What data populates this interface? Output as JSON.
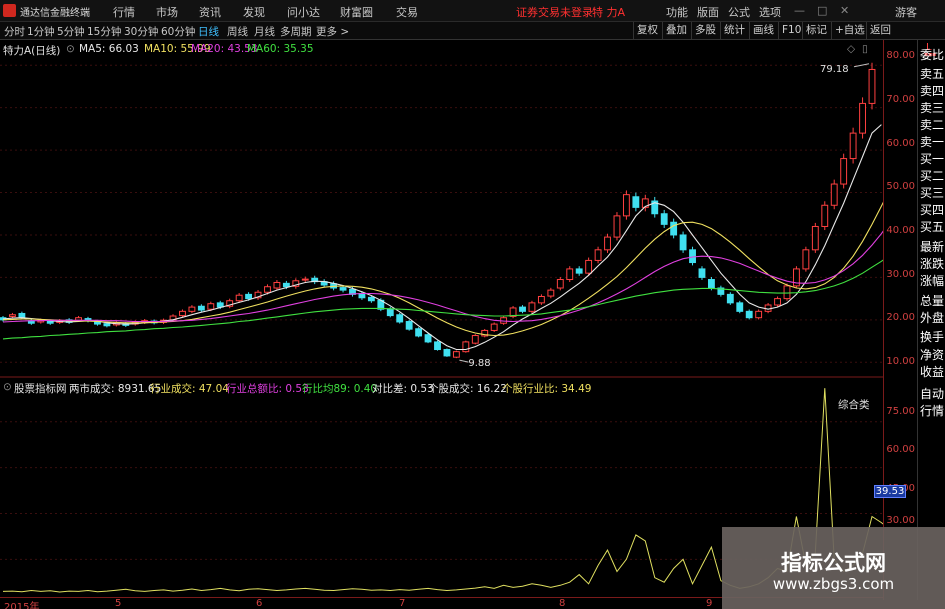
{
  "topbar": {
    "app_name": "通达信金融终端",
    "menu": [
      "行情",
      "市场",
      "资讯",
      "发现",
      "问小达",
      "财富圈",
      "交易"
    ],
    "trade_status": "证券交易未登录",
    "stock_name": "特 力A",
    "right_menu": [
      "功能",
      "版面",
      "公式",
      "选项"
    ],
    "guest": "游客",
    "colors": {
      "logo": "#d0281f",
      "alert": "#ff3030"
    }
  },
  "tabs": {
    "periods": [
      "分时",
      "1分钟",
      "5分钟",
      "15分钟",
      "30分钟",
      "60分钟",
      "日线",
      "周线",
      "月线",
      "多周期",
      "更多 >"
    ],
    "active_period": "日线",
    "right_buttons": [
      "复权",
      "叠加",
      "多股",
      "统计",
      "画线",
      "F10",
      "标记",
      "+自选",
      "返回"
    ]
  },
  "price_legend": {
    "title": "特力A(日线)",
    "ma": [
      {
        "label": "MA5: 66.03",
        "color": "#e8e8e8"
      },
      {
        "label": "MA10: 55.99",
        "color": "#f0e060"
      },
      {
        "label": "MA20: 43.53",
        "color": "#e040e0"
      },
      {
        "label": "MA60: 35.35",
        "color": "#40e040"
      }
    ],
    "high_label": "79.18",
    "low_label": "9.88"
  },
  "indicator_legend": {
    "title": "股票指标网",
    "items": [
      {
        "label": "两市成交: 8931.65",
        "color": "#e8e8e8"
      },
      {
        "label": "行业成交: 47.04",
        "color": "#f0e060"
      },
      {
        "label": "行业总额比: 0.53",
        "color": "#e040e0"
      },
      {
        "label": "行比均89: 0.40",
        "color": "#40e040"
      },
      {
        "label": "对比差: 0.53",
        "color": "#e8e8e8"
      },
      {
        "label": "个股成交: 16.22",
        "color": "#e8e8e8"
      },
      {
        "label": "个股行业比: 34.49",
        "color": "#f0e060"
      }
    ],
    "panel_label": "综合类",
    "current_value": "39.53"
  },
  "price_axis": [
    "80.00",
    "70.00",
    "60.00",
    "50.00",
    "40.00",
    "30.00",
    "20.00",
    "10.00"
  ],
  "indicator_axis": [
    "75.00",
    "60.00",
    "45.00",
    "30.00"
  ],
  "date_axis": [
    "2015年",
    "5",
    "6",
    "7",
    "8",
    "9"
  ],
  "sidebar": {
    "items": [
      "委比",
      "卖五",
      "卖四",
      "卖三",
      "卖二",
      "卖一",
      "买一",
      "买二",
      "买三",
      "买四",
      "买五",
      "最新",
      "涨跌",
      "涨幅",
      "总量",
      "外盘",
      "换手",
      "净资",
      "收益",
      "自动",
      "行情"
    ]
  },
  "watermark": {
    "line1": "指标公式网",
    "line2": "www.zbgs3.com"
  },
  "chart_data": [
    {
      "type": "candlestick",
      "title": "特力A(日线)",
      "ylim": [
        7,
        85
      ],
      "y_ticks": [
        10,
        20,
        30,
        40,
        50,
        60,
        70,
        80
      ],
      "candles": [
        {
          "o": 20.5,
          "c": 20.0
        },
        {
          "o": 20.8,
          "c": 21.2
        },
        {
          "o": 21.5,
          "c": 20.6
        },
        {
          "o": 19.8,
          "c": 19.2
        },
        {
          "o": 19.5,
          "c": 19.9
        },
        {
          "o": 19.7,
          "c": 19.2
        },
        {
          "o": 19.4,
          "c": 19.8
        },
        {
          "o": 20.0,
          "c": 19.4
        },
        {
          "o": 19.9,
          "c": 20.5
        },
        {
          "o": 20.3,
          "c": 19.8
        },
        {
          "o": 19.6,
          "c": 19.0
        },
        {
          "o": 19.1,
          "c": 18.6
        },
        {
          "o": 18.8,
          "c": 19.3
        },
        {
          "o": 19.1,
          "c": 18.7
        },
        {
          "o": 19.0,
          "c": 19.5
        },
        {
          "o": 19.4,
          "c": 19.8
        },
        {
          "o": 19.7,
          "c": 19.3
        },
        {
          "o": 19.4,
          "c": 19.9
        },
        {
          "o": 20.0,
          "c": 20.9
        },
        {
          "o": 21.0,
          "c": 22.0
        },
        {
          "o": 22.0,
          "c": 23.0
        },
        {
          "o": 23.2,
          "c": 22.3
        },
        {
          "o": 22.5,
          "c": 23.8
        },
        {
          "o": 24.0,
          "c": 23.0
        },
        {
          "o": 23.2,
          "c": 24.5
        },
        {
          "o": 24.5,
          "c": 25.8
        },
        {
          "o": 26.0,
          "c": 25.0
        },
        {
          "o": 25.2,
          "c": 26.5
        },
        {
          "o": 26.5,
          "c": 27.8
        },
        {
          "o": 27.5,
          "c": 28.8
        },
        {
          "o": 28.6,
          "c": 27.8
        },
        {
          "o": 27.9,
          "c": 29.2
        },
        {
          "o": 29.4,
          "c": 29.6
        },
        {
          "o": 29.8,
          "c": 29.0
        },
        {
          "o": 29.0,
          "c": 28.2
        },
        {
          "o": 28.5,
          "c": 27.5
        },
        {
          "o": 27.6,
          "c": 27.0
        },
        {
          "o": 27.2,
          "c": 26.0
        },
        {
          "o": 26.2,
          "c": 25.2
        },
        {
          "o": 25.3,
          "c": 24.5
        },
        {
          "o": 24.6,
          "c": 22.5
        },
        {
          "o": 22.6,
          "c": 21.0
        },
        {
          "o": 21.2,
          "c": 19.5
        },
        {
          "o": 19.6,
          "c": 17.8
        },
        {
          "o": 17.9,
          "c": 16.2
        },
        {
          "o": 16.5,
          "c": 14.8
        },
        {
          "o": 14.8,
          "c": 13.0
        },
        {
          "o": 13.0,
          "c": 11.5
        },
        {
          "o": 11.2,
          "c": 12.5
        },
        {
          "o": 12.5,
          "c": 14.8
        },
        {
          "o": 14.5,
          "c": 16.3
        },
        {
          "o": 16.2,
          "c": 17.5
        },
        {
          "o": 17.5,
          "c": 19.0
        },
        {
          "o": 19.2,
          "c": 20.5
        },
        {
          "o": 20.8,
          "c": 22.8
        },
        {
          "o": 23.0,
          "c": 22.0
        },
        {
          "o": 22.0,
          "c": 24.0
        },
        {
          "o": 24.0,
          "c": 25.5
        },
        {
          "o": 25.6,
          "c": 27.0
        },
        {
          "o": 27.5,
          "c": 29.5
        },
        {
          "o": 29.5,
          "c": 32.0
        },
        {
          "o": 32.0,
          "c": 31.0
        },
        {
          "o": 31.0,
          "c": 34.0
        },
        {
          "o": 34.0,
          "c": 36.5
        },
        {
          "o": 36.5,
          "c": 39.5
        },
        {
          "o": 39.5,
          "c": 44.5
        },
        {
          "o": 44.5,
          "c": 49.5
        },
        {
          "o": 49.0,
          "c": 46.5
        },
        {
          "o": 46.5,
          "c": 48.5
        },
        {
          "o": 48.0,
          "c": 45.0
        },
        {
          "o": 45.0,
          "c": 42.5
        },
        {
          "o": 43.0,
          "c": 40.0
        },
        {
          "o": 40.0,
          "c": 36.5
        },
        {
          "o": 36.5,
          "c": 33.5
        },
        {
          "o": 32.0,
          "c": 30.0
        },
        {
          "o": 29.5,
          "c": 27.5
        },
        {
          "o": 27.5,
          "c": 26.0
        },
        {
          "o": 26.0,
          "c": 24.0
        },
        {
          "o": 24.0,
          "c": 22.0
        },
        {
          "o": 22.0,
          "c": 20.5
        },
        {
          "o": 20.5,
          "c": 22.0
        },
        {
          "o": 22.0,
          "c": 23.5
        },
        {
          "o": 23.5,
          "c": 25.0
        },
        {
          "o": 25.0,
          "c": 28.0
        },
        {
          "o": 28.0,
          "c": 32.0
        },
        {
          "o": 32.0,
          "c": 36.5
        },
        {
          "o": 36.5,
          "c": 42.0
        },
        {
          "o": 42.0,
          "c": 47.0
        },
        {
          "o": 47.0,
          "c": 52.0
        },
        {
          "o": 52.0,
          "c": 58.0
        },
        {
          "o": 58.0,
          "c": 64.0
        },
        {
          "o": 64.0,
          "c": 71.0
        },
        {
          "o": 71.0,
          "c": 79.0
        }
      ],
      "series": [
        {
          "name": "MA5",
          "color": "#e8e8e8",
          "values": [
            20.2,
            20.4,
            20.5,
            20.3,
            20.1,
            19.8,
            19.6,
            19.5,
            19.6,
            19.8,
            19.7,
            19.3,
            19.1,
            19.0,
            19.1,
            19.3,
            19.5,
            19.7,
            20.0,
            20.6,
            21.2,
            21.8,
            22.3,
            22.9,
            23.5,
            24.1,
            24.7,
            25.4,
            26.2,
            27.0,
            27.6,
            28.2,
            28.8,
            29.1,
            29.0,
            28.6,
            28.1,
            27.4,
            26.6,
            25.7,
            24.6,
            23.3,
            21.9,
            20.3,
            18.6,
            16.9,
            15.3,
            13.9,
            13.0,
            13.0,
            13.7,
            14.7,
            15.9,
            17.2,
            18.8,
            20.2,
            21.4,
            22.7,
            23.9,
            25.4,
            27.0,
            28.6,
            30.5,
            32.7,
            34.8,
            37.6,
            41.0,
            44.5,
            46.7,
            47.6,
            47.0,
            45.5,
            43.0,
            40.0,
            37.0,
            34.0,
            31.0,
            28.5,
            26.0,
            24.0,
            23.0,
            22.5,
            23.0,
            24.0,
            26.0,
            29.0,
            33.0,
            37.5,
            42.5,
            47.5,
            53.0,
            58.5,
            64.0,
            66.0
          ]
        },
        {
          "name": "MA10",
          "color": "#f0e060",
          "values": [
            20.0,
            20.1,
            20.2,
            20.2,
            20.1,
            20.0,
            19.9,
            19.8,
            19.7,
            19.7,
            19.6,
            19.5,
            19.4,
            19.3,
            19.3,
            19.3,
            19.4,
            19.5,
            19.6,
            19.8,
            20.1,
            20.5,
            20.9,
            21.3,
            21.8,
            22.4,
            23.0,
            23.6,
            24.2,
            24.9,
            25.6,
            26.2,
            26.8,
            27.3,
            27.7,
            27.9,
            28.0,
            27.9,
            27.7,
            27.3,
            26.7,
            26.0,
            25.1,
            24.0,
            22.8,
            21.6,
            20.4,
            19.3,
            18.3,
            17.5,
            16.9,
            16.5,
            16.3,
            16.4,
            16.8,
            17.4,
            18.1,
            18.9,
            19.9,
            21.0,
            22.2,
            23.6,
            25.1,
            26.7,
            28.4,
            30.2,
            32.3,
            34.6,
            36.9,
            39.0,
            40.8,
            42.2,
            42.9,
            43.0,
            42.5,
            41.5,
            40.0,
            38.3,
            36.4,
            34.4,
            32.5,
            30.7,
            29.2,
            28.2,
            27.5,
            27.3,
            27.6,
            28.5,
            30.0,
            32.2,
            35.0,
            38.5,
            42.5,
            46.8,
            51.2,
            56.0
          ]
        },
        {
          "name": "MA20",
          "color": "#e040e0",
          "values": [
            19.5,
            19.6,
            19.7,
            19.8,
            19.8,
            19.9,
            19.9,
            19.9,
            19.9,
            19.9,
            19.9,
            19.8,
            19.8,
            19.7,
            19.6,
            19.6,
            19.6,
            19.6,
            19.7,
            19.8,
            19.9,
            20.1,
            20.3,
            20.6,
            20.9,
            21.2,
            21.5,
            21.9,
            22.3,
            22.8,
            23.3,
            23.8,
            24.3,
            24.8,
            25.2,
            25.6,
            25.9,
            26.1,
            26.2,
            26.2,
            26.1,
            25.9,
            25.6,
            25.2,
            24.7,
            24.1,
            23.5,
            22.8,
            22.1,
            21.4,
            20.8,
            20.3,
            19.9,
            19.7,
            19.6,
            19.7,
            19.8,
            20.1,
            20.5,
            21.0,
            21.6,
            22.3,
            23.1,
            24.0,
            25.0,
            26.1,
            27.3,
            28.6,
            30.0,
            31.4,
            32.6,
            33.6,
            34.4,
            34.8,
            35.0,
            34.9,
            34.6,
            34.0,
            33.3,
            32.4,
            31.5,
            30.6,
            29.8,
            29.1,
            28.7,
            28.6,
            28.8,
            29.4,
            30.3,
            31.6,
            33.2,
            35.2,
            37.6,
            40.3,
            43.5
          ]
        },
        {
          "name": "MA60",
          "color": "#40e040",
          "values": [
            15.5,
            15.7,
            15.8,
            16.0,
            16.1,
            16.3,
            16.4,
            16.6,
            16.7,
            16.9,
            17.0,
            17.2,
            17.3,
            17.4,
            17.6,
            17.7,
            17.9,
            18.0,
            18.2,
            18.3,
            18.5,
            18.7,
            18.9,
            19.1,
            19.3,
            19.6,
            19.8,
            20.1,
            20.4,
            20.7,
            21.0,
            21.3,
            21.6,
            21.9,
            22.1,
            22.3,
            22.5,
            22.6,
            22.7,
            22.7,
            22.7,
            22.6,
            22.5,
            22.4,
            22.2,
            22.0,
            21.8,
            21.6,
            21.4,
            21.2,
            21.1,
            21.0,
            20.9,
            20.9,
            21.0,
            21.1,
            21.2,
            21.4,
            21.7,
            22.0,
            22.3,
            22.7,
            23.1,
            23.6,
            24.1,
            24.6,
            25.1,
            25.6,
            26.0,
            26.4,
            26.7,
            27.0,
            27.2,
            27.3,
            27.4,
            27.4,
            27.3,
            27.1,
            26.9,
            26.7,
            26.5,
            26.4,
            26.3,
            26.3,
            26.4,
            26.6,
            26.9,
            27.4,
            28.0,
            28.8,
            29.8,
            31.0,
            32.4,
            33.8,
            35.35
          ]
        }
      ]
    },
    {
      "type": "line",
      "title": "股票指标网",
      "ylim": [
        18,
        88
      ],
      "y_ticks": [
        30,
        45,
        60,
        75
      ],
      "series": [
        {
          "name": "个股行业比",
          "color": "#e0e060",
          "values": [
            19.5,
            19.6,
            19.4,
            19.8,
            19.5,
            19.7,
            19.3,
            19.6,
            19.5,
            19.8,
            19.4,
            19.6,
            19.9,
            20.2,
            19.7,
            19.5,
            19.8,
            20.0,
            19.6,
            19.9,
            20.3,
            19.8,
            20.1,
            20.5,
            20.0,
            19.7,
            20.2,
            20.4,
            20.1,
            19.8,
            20.0,
            20.3,
            20.5,
            20.2,
            19.9,
            19.8,
            20.1,
            20.4,
            20.2,
            19.9,
            20.0,
            19.8,
            20.1,
            19.9,
            20.2,
            20.5,
            20.1,
            19.8,
            20.0,
            20.3,
            20.6,
            21.0,
            20.5,
            21.5,
            20.8,
            21.2,
            22.0,
            21.5,
            20.8,
            21.5,
            22.5,
            25.0,
            22.0,
            28.0,
            33.0,
            26.0,
            30.0,
            38.0,
            36.0,
            24.0,
            22.5,
            27.0,
            30.0,
            22.0,
            28.0,
            34.0,
            23.0,
            21.5,
            20.5,
            21.0,
            22.0,
            24.0,
            27.0,
            26.0,
            44.0,
            28.0,
            32.0,
            86.0,
            30.0,
            26.0,
            28.0,
            32.0,
            44.0,
            42.0,
            39.53
          ]
        }
      ]
    }
  ]
}
